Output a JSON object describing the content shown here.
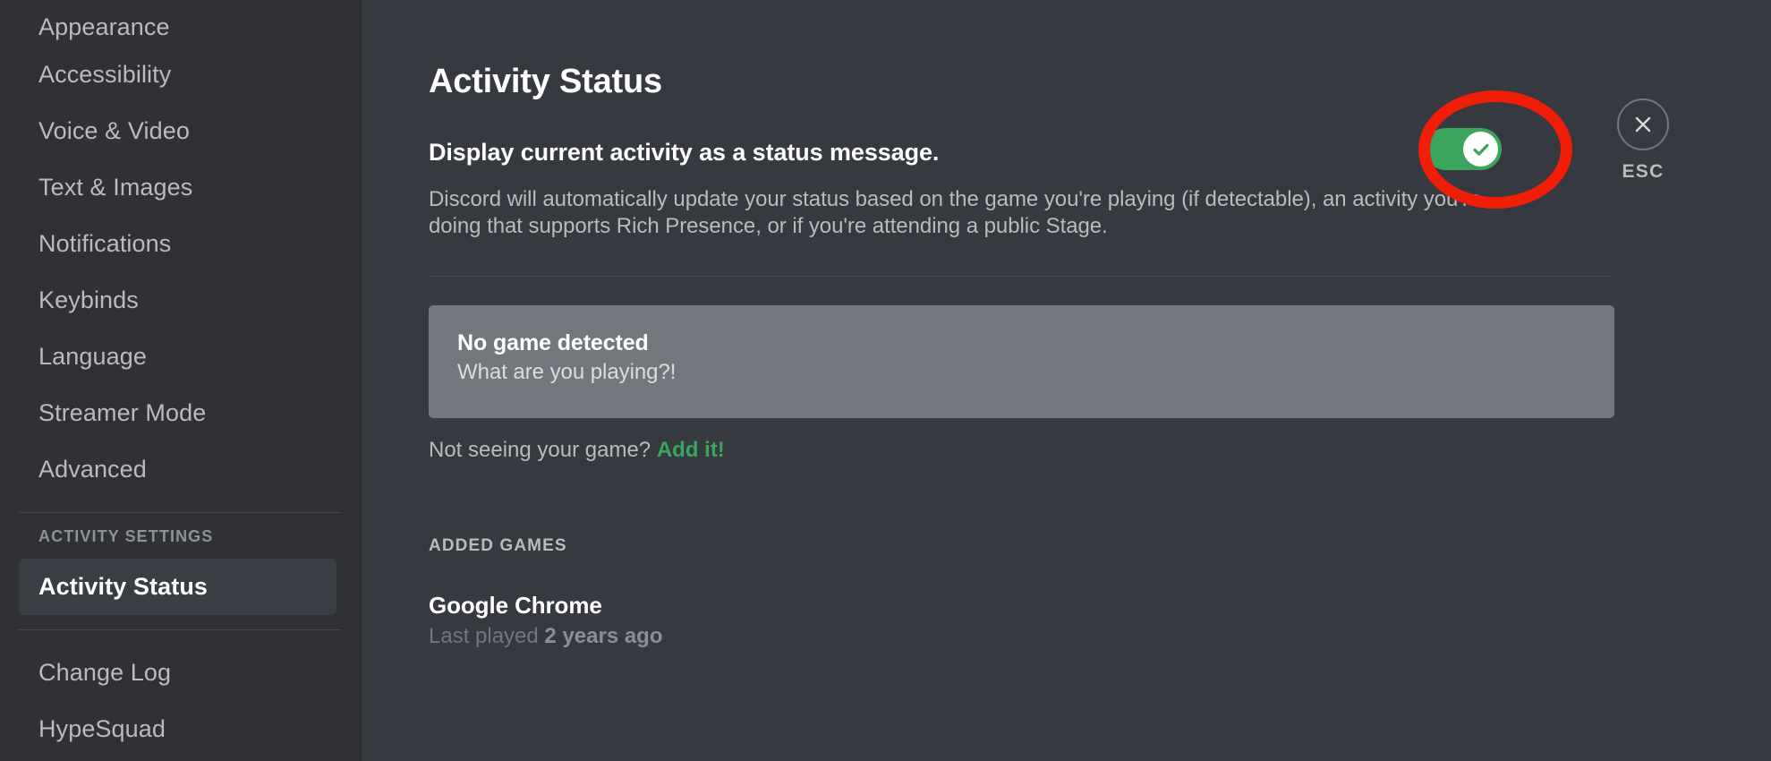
{
  "sidebar": {
    "items": [
      {
        "label": "Appearance",
        "active": false
      },
      {
        "label": "Accessibility",
        "active": false
      },
      {
        "label": "Voice & Video",
        "active": false
      },
      {
        "label": "Text & Images",
        "active": false
      },
      {
        "label": "Notifications",
        "active": false
      },
      {
        "label": "Keybinds",
        "active": false
      },
      {
        "label": "Language",
        "active": false
      },
      {
        "label": "Streamer Mode",
        "active": false
      },
      {
        "label": "Advanced",
        "active": false
      }
    ],
    "activity_section_header": "ACTIVITY SETTINGS",
    "activity_items": [
      {
        "label": "Activity Status",
        "active": true
      }
    ],
    "bottom_items": [
      {
        "label": "Change Log",
        "active": false
      },
      {
        "label": "HypeSquad",
        "active": false
      }
    ]
  },
  "main": {
    "title": "Activity Status",
    "toggle_label": "Display current activity as a status message.",
    "toggle_state": "on",
    "toggle_icon": "check-icon",
    "description": "Discord will automatically update your status based on the game you're playing (if detectable), an activity you're doing that supports Rich Presence, or if you're attending a public Stage.",
    "game_card": {
      "title": "No game detected",
      "subtitle": "What are you playing?!"
    },
    "add_game": {
      "prompt": "Not seeing your game?",
      "link_label": "Add it!"
    },
    "added_games_header": "ADDED GAMES",
    "added_games": [
      {
        "name": "Google Chrome",
        "meta_prefix": "Last played ",
        "meta_value": "2 years ago"
      }
    ]
  },
  "close": {
    "icon": "close-x-icon",
    "label": "ESC"
  },
  "annotation": {
    "shape": "red-ellipse-highlight",
    "color": "#f01e06",
    "target": "activity-status-toggle"
  },
  "colors": {
    "sidebar_bg": "#2f3136",
    "main_bg": "#36393f",
    "toggle_on": "#3ba55d",
    "link_green": "#3ba55d",
    "card_bg": "#72767d",
    "annotation_red": "#f01e06"
  }
}
